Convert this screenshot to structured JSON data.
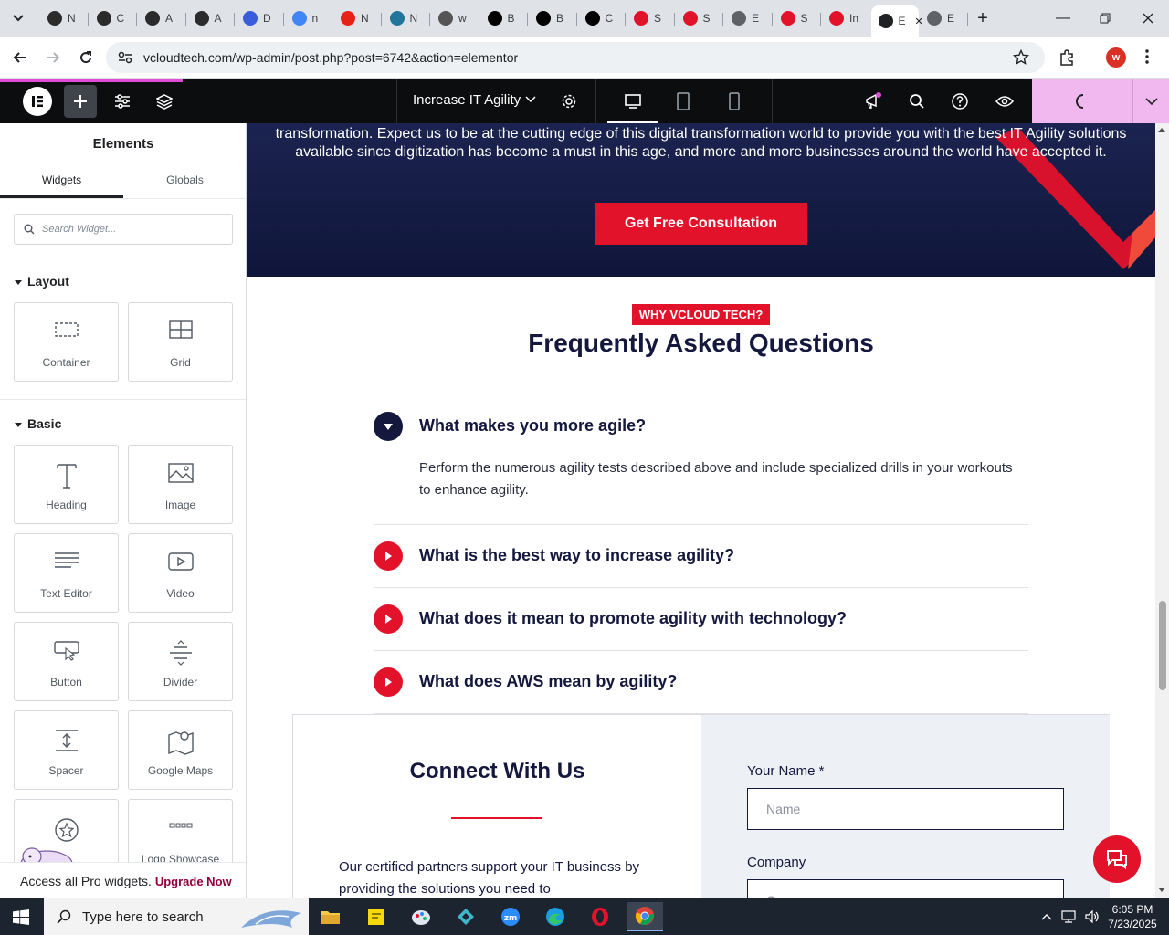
{
  "browser": {
    "tabs": [
      {
        "label": "N",
        "color": "#2b2b2b"
      },
      {
        "label": "C",
        "color": "#2b2b2b"
      },
      {
        "label": "A",
        "color": "#2b2b2b"
      },
      {
        "label": "A",
        "color": "#2b2b2b"
      },
      {
        "label": "D",
        "color": "#3b5ddb"
      },
      {
        "label": "n",
        "color": "#4285f4"
      },
      {
        "label": "N",
        "color": "#e62117"
      },
      {
        "label": "N",
        "color": "#21759b"
      },
      {
        "label": "w",
        "color": "#555555"
      },
      {
        "label": "B",
        "color": "#000000"
      },
      {
        "label": "B",
        "color": "#000000"
      },
      {
        "label": "C",
        "color": "#000000"
      },
      {
        "label": "S",
        "color": "#e3122b"
      },
      {
        "label": "S",
        "color": "#e3122b"
      },
      {
        "label": "E",
        "color": "#5f6368"
      },
      {
        "label": "S",
        "color": "#e3122b"
      },
      {
        "label": "In",
        "color": "#e3122b"
      },
      {
        "label": "E",
        "color": "#202124"
      },
      {
        "label": "E",
        "color": "#5f6368"
      }
    ],
    "url": "vcloudtech.com/wp-admin/post.php?post=6742&action=elementor",
    "profile_initial": "w"
  },
  "editor": {
    "page_name": "Increase IT Agility"
  },
  "panel": {
    "title": "Elements",
    "tabs": [
      "Widgets",
      "Globals"
    ],
    "search_placeholder": "Search Widget...",
    "layout_label": "Layout",
    "basic_label": "Basic",
    "layout_widgets": [
      "Container",
      "Grid"
    ],
    "basic_widgets": [
      "Heading",
      "Image",
      "Text Editor",
      "Video",
      "Button",
      "Divider",
      "Spacer",
      "Google Maps",
      "",
      "Logo Showcase"
    ],
    "upgrade_text": "Access all Pro widgets.",
    "upgrade_link": "Upgrade Now"
  },
  "canvas": {
    "hero_text": "transformation. Expect us to be at the cutting edge of this digital transformation world to provide you with the best IT Agility solutions available since digitization has become a must in this age, and more and more businesses around the world have accepted it.",
    "hero_button": "Get Free Consultation",
    "faq_badge": "WHY VCLOUD TECH?",
    "faq_title": "Frequently Asked Questions",
    "faqs": [
      {
        "q": "What makes you more agile?",
        "open": true
      },
      {
        "q": "What is the best way to increase agility?",
        "open": false
      },
      {
        "q": "What does it mean to promote agility with technology?",
        "open": false
      },
      {
        "q": "What does AWS mean by agility?",
        "open": false
      }
    ],
    "faq_answer": "Perform the numerous agility tests described above and include specialized drills in your workouts to enhance agility.",
    "connect_title": "Connect With Us",
    "connect_text": "Our certified partners support your IT business by providing the solutions you need to",
    "name_label": "Your Name *",
    "name_placeholder": "Name",
    "company_label": "Company",
    "company_placeholder": "Company"
  },
  "taskbar": {
    "search_placeholder": "Type here to search",
    "time": "6:05 PM",
    "date": "7/23/2025"
  },
  "colors": {
    "accent": "#e3122b",
    "navy": "#14183d",
    "elementor_bar": "#0c0d0e",
    "publish": "#f0b8ee"
  }
}
